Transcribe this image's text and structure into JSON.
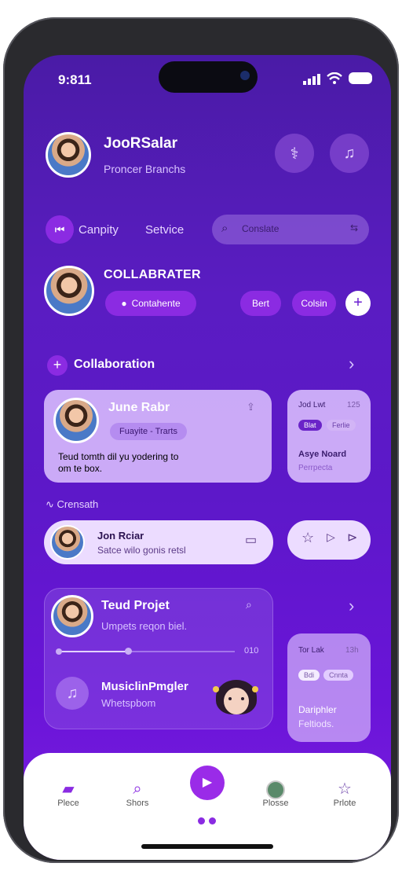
{
  "status": {
    "time": "9:811",
    "signal_icon": "signal-bars-icon",
    "wifi_icon": "wifi-icon",
    "battery_icon": "battery-icon"
  },
  "profile": {
    "name": "JooRSalar",
    "subtitle": "Proncer Branchs",
    "header_icons": [
      "stethoscope-icon",
      "music-note-icon"
    ]
  },
  "filters": {
    "tab1": "Canpity",
    "tab2": "Setvice",
    "search_placeholder": "Conslate"
  },
  "collab_head": {
    "title": "COLLABRATER",
    "primary": "Contahente",
    "btn2": "Bert",
    "btn3": "Colsin",
    "plus": "+"
  },
  "section": {
    "title": "Collaboration",
    "add": "+",
    "arrow": "›"
  },
  "card1": {
    "name": "June Rabr",
    "tag": "Fuayite - Trarts",
    "desc": "Teud tomth dil yu yodering to\nom te box."
  },
  "card2": {
    "title": "Jod Lwt",
    "counter": "125",
    "chip1": "Blat",
    "chip2": "Ferlie",
    "name": "Asye Noard",
    "sub": "Perrpecta"
  },
  "convo": {
    "label": "Crensath",
    "name": "Jon Rciar",
    "msg": "Satce wilo gonis retsl"
  },
  "project": {
    "title": "Teud Projet",
    "sub": "Umpets reqon biel.",
    "time": "010",
    "track": "MusiclinPmgler",
    "track_sub": "Whetspbom",
    "progress": 0.4
  },
  "card3": {
    "title": "Tor Lak",
    "counter": "13h",
    "chip1": "Bdi",
    "chip2": "Cnnta",
    "name": "Dariphler",
    "sub": "Feltiods.",
    "arrow": "›"
  },
  "nav": [
    {
      "label": "Plece",
      "icon": "shopping-bag-icon"
    },
    {
      "label": "Shors",
      "icon": "search-icon"
    },
    {
      "label": "",
      "icon": "play-icon"
    },
    {
      "label": "Plosse",
      "icon": "profile-icon"
    },
    {
      "label": "Prlote",
      "icon": "star-icon"
    }
  ]
}
